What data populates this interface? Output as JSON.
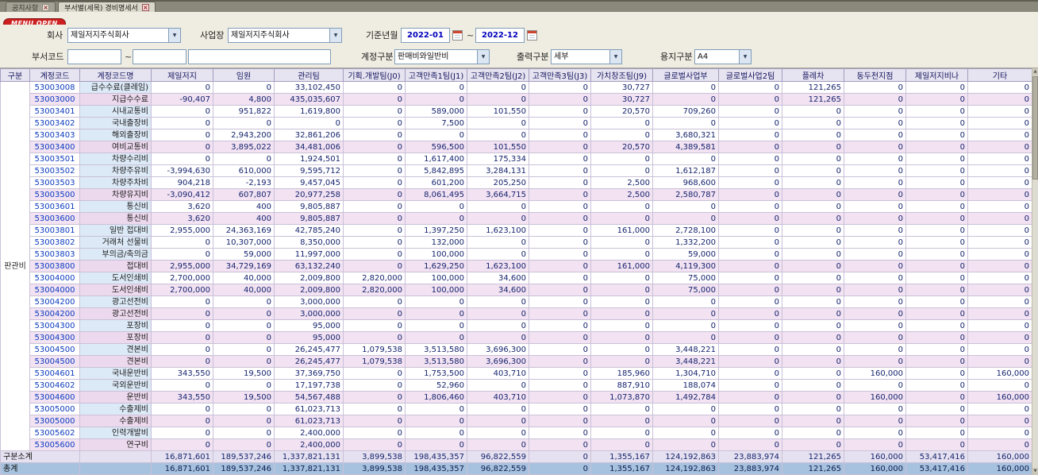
{
  "icons": {
    "close": "×",
    "dropdown": "▼",
    "scroll_up": "▲",
    "scroll_down": "▼"
  },
  "tabs": [
    {
      "label": "공지사항"
    },
    {
      "label": "부서별(세목) 경비명세서"
    }
  ],
  "menu_open_label": "MENU OPEN",
  "filters": {
    "company": {
      "label": "회사",
      "value": "제일저지주식회사"
    },
    "workplace": {
      "label": "사업장",
      "value": "제일저지주식회사"
    },
    "period": {
      "label": "기준년월",
      "from": "2022-01",
      "to": "2022-12",
      "separator": "~"
    },
    "dept_code": {
      "label": "부서코드",
      "from": "",
      "to": "",
      "separator": "~"
    },
    "account_type": {
      "label": "계정구분",
      "value": "판매비와일반비"
    },
    "output_type": {
      "label": "출력구분",
      "value": "세부"
    },
    "paper_type": {
      "label": "용지구분",
      "value": "A4"
    }
  },
  "grid": {
    "columns": [
      "구분",
      "계정코드",
      "계정코드명",
      "제일저지",
      "임원",
      "관리팀",
      "기획.개발팀(J0)",
      "고객만족1팀(J1)",
      "고객만족2팀(J2)",
      "고객만족3팀(J3)",
      "가치창조팀(J9)",
      "글로벌사업부",
      "글로벌사업2팀",
      "플레차",
      "동두천지점",
      "제일저지비나",
      "기타"
    ],
    "group_label": "판관비",
    "rows": [
      {
        "code": "53003008",
        "name": "급수수료(클레임)",
        "kind": "detail",
        "values": [
          "0",
          "0",
          "33,102,450",
          "0",
          "0",
          "0",
          "0",
          "30,727",
          "0",
          "0",
          "121,265",
          "0",
          "0",
          "0"
        ]
      },
      {
        "code": "53003000",
        "name": "지급수수료",
        "kind": "sum",
        "values": [
          "-90,407",
          "4,800",
          "435,035,607",
          "0",
          "0",
          "0",
          "0",
          "30,727",
          "0",
          "0",
          "121,265",
          "0",
          "0",
          "0"
        ]
      },
      {
        "code": "53003401",
        "name": "시내교통비",
        "kind": "detail",
        "values": [
          "0",
          "951,822",
          "1,619,800",
          "0",
          "589,000",
          "101,550",
          "0",
          "20,570",
          "709,260",
          "0",
          "0",
          "0",
          "0",
          "0"
        ]
      },
      {
        "code": "53003402",
        "name": "국내출장비",
        "kind": "detail",
        "values": [
          "0",
          "0",
          "0",
          "0",
          "7,500",
          "0",
          "0",
          "0",
          "0",
          "0",
          "0",
          "0",
          "0",
          "0"
        ]
      },
      {
        "code": "53003403",
        "name": "해외출장비",
        "kind": "detail",
        "values": [
          "0",
          "2,943,200",
          "32,861,206",
          "0",
          "0",
          "0",
          "0",
          "0",
          "3,680,321",
          "0",
          "0",
          "0",
          "0",
          "0"
        ]
      },
      {
        "code": "53003400",
        "name": "여비교통비",
        "kind": "sum",
        "values": [
          "0",
          "3,895,022",
          "34,481,006",
          "0",
          "596,500",
          "101,550",
          "0",
          "20,570",
          "4,389,581",
          "0",
          "0",
          "0",
          "0",
          "0"
        ]
      },
      {
        "code": "53003501",
        "name": "차량수리비",
        "kind": "detail",
        "values": [
          "0",
          "0",
          "1,924,501",
          "0",
          "1,617,400",
          "175,334",
          "0",
          "0",
          "0",
          "0",
          "0",
          "0",
          "0",
          "0"
        ]
      },
      {
        "code": "53003502",
        "name": "차량주유비",
        "kind": "detail",
        "values": [
          "-3,994,630",
          "610,000",
          "9,595,712",
          "0",
          "5,842,895",
          "3,284,131",
          "0",
          "0",
          "1,612,187",
          "0",
          "0",
          "0",
          "0",
          "0"
        ]
      },
      {
        "code": "53003503",
        "name": "차량주차비",
        "kind": "detail",
        "values": [
          "904,218",
          "-2,193",
          "9,457,045",
          "0",
          "601,200",
          "205,250",
          "0",
          "2,500",
          "968,600",
          "0",
          "0",
          "0",
          "0",
          "0"
        ]
      },
      {
        "code": "53003500",
        "name": "차량유지비",
        "kind": "sum",
        "values": [
          "-3,090,412",
          "607,807",
          "20,977,258",
          "0",
          "8,061,495",
          "3,664,715",
          "0",
          "2,500",
          "2,580,787",
          "0",
          "0",
          "0",
          "0",
          "0"
        ]
      },
      {
        "code": "53003601",
        "name": "통신비",
        "kind": "detail",
        "values": [
          "3,620",
          "400",
          "9,805,887",
          "0",
          "0",
          "0",
          "0",
          "0",
          "0",
          "0",
          "0",
          "0",
          "0",
          "0"
        ]
      },
      {
        "code": "53003600",
        "name": "통신비",
        "kind": "sum",
        "values": [
          "3,620",
          "400",
          "9,805,887",
          "0",
          "0",
          "0",
          "0",
          "0",
          "0",
          "0",
          "0",
          "0",
          "0",
          "0"
        ]
      },
      {
        "code": "53003801",
        "name": "일반 접대비",
        "kind": "detail",
        "values": [
          "2,955,000",
          "24,363,169",
          "42,785,240",
          "0",
          "1,397,250",
          "1,623,100",
          "0",
          "161,000",
          "2,728,100",
          "0",
          "0",
          "0",
          "0",
          "0"
        ]
      },
      {
        "code": "53003802",
        "name": "거래처 선물비",
        "kind": "detail",
        "values": [
          "0",
          "10,307,000",
          "8,350,000",
          "0",
          "132,000",
          "0",
          "0",
          "0",
          "1,332,200",
          "0",
          "0",
          "0",
          "0",
          "0"
        ]
      },
      {
        "code": "53003803",
        "name": "부의금/축의금",
        "kind": "detail",
        "values": [
          "0",
          "59,000",
          "11,997,000",
          "0",
          "100,000",
          "0",
          "0",
          "0",
          "59,000",
          "0",
          "0",
          "0",
          "0",
          "0"
        ]
      },
      {
        "code": "53003800",
        "name": "접대비",
        "kind": "sum",
        "values": [
          "2,955,000",
          "34,729,169",
          "63,132,240",
          "0",
          "1,629,250",
          "1,623,100",
          "0",
          "161,000",
          "4,119,300",
          "0",
          "0",
          "0",
          "0",
          "0"
        ]
      },
      {
        "code": "53004000",
        "name": "도서인쇄비",
        "kind": "detail",
        "values": [
          "2,700,000",
          "40,000",
          "2,009,800",
          "2,820,000",
          "100,000",
          "34,600",
          "0",
          "0",
          "75,000",
          "0",
          "0",
          "0",
          "0",
          "0"
        ]
      },
      {
        "code": "53004000",
        "name": "도서인쇄비",
        "kind": "sum",
        "values": [
          "2,700,000",
          "40,000",
          "2,009,800",
          "2,820,000",
          "100,000",
          "34,600",
          "0",
          "0",
          "75,000",
          "0",
          "0",
          "0",
          "0",
          "0"
        ]
      },
      {
        "code": "53004200",
        "name": "광고선전비",
        "kind": "detail",
        "values": [
          "0",
          "0",
          "3,000,000",
          "0",
          "0",
          "0",
          "0",
          "0",
          "0",
          "0",
          "0",
          "0",
          "0",
          "0"
        ]
      },
      {
        "code": "53004200",
        "name": "광고선전비",
        "kind": "sum",
        "values": [
          "0",
          "0",
          "3,000,000",
          "0",
          "0",
          "0",
          "0",
          "0",
          "0",
          "0",
          "0",
          "0",
          "0",
          "0"
        ]
      },
      {
        "code": "53004300",
        "name": "포장비",
        "kind": "detail",
        "values": [
          "0",
          "0",
          "95,000",
          "0",
          "0",
          "0",
          "0",
          "0",
          "0",
          "0",
          "0",
          "0",
          "0",
          "0"
        ]
      },
      {
        "code": "53004300",
        "name": "포장비",
        "kind": "sum",
        "values": [
          "0",
          "0",
          "95,000",
          "0",
          "0",
          "0",
          "0",
          "0",
          "0",
          "0",
          "0",
          "0",
          "0",
          "0"
        ]
      },
      {
        "code": "53004500",
        "name": "견본비",
        "kind": "detail",
        "values": [
          "0",
          "0",
          "26,245,477",
          "1,079,538",
          "3,513,580",
          "3,696,300",
          "0",
          "0",
          "3,448,221",
          "0",
          "0",
          "0",
          "0",
          "0"
        ]
      },
      {
        "code": "53004500",
        "name": "견본비",
        "kind": "sum",
        "values": [
          "0",
          "0",
          "26,245,477",
          "1,079,538",
          "3,513,580",
          "3,696,300",
          "0",
          "0",
          "3,448,221",
          "0",
          "0",
          "0",
          "0",
          "0"
        ]
      },
      {
        "code": "53004601",
        "name": "국내운반비",
        "kind": "detail",
        "values": [
          "343,550",
          "19,500",
          "37,369,750",
          "0",
          "1,753,500",
          "403,710",
          "0",
          "185,960",
          "1,304,710",
          "0",
          "0",
          "160,000",
          "0",
          "160,000"
        ]
      },
      {
        "code": "53004602",
        "name": "국외운반비",
        "kind": "detail",
        "values": [
          "0",
          "0",
          "17,197,738",
          "0",
          "52,960",
          "0",
          "0",
          "887,910",
          "188,074",
          "0",
          "0",
          "0",
          "0",
          "0"
        ]
      },
      {
        "code": "53004600",
        "name": "운반비",
        "kind": "sum",
        "values": [
          "343,550",
          "19,500",
          "54,567,488",
          "0",
          "1,806,460",
          "403,710",
          "0",
          "1,073,870",
          "1,492,784",
          "0",
          "0",
          "160,000",
          "0",
          "160,000"
        ]
      },
      {
        "code": "53005000",
        "name": "수출제비",
        "kind": "detail",
        "values": [
          "0",
          "0",
          "61,023,713",
          "0",
          "0",
          "0",
          "0",
          "0",
          "0",
          "0",
          "0",
          "0",
          "0",
          "0"
        ]
      },
      {
        "code": "53005000",
        "name": "수출제비",
        "kind": "sum",
        "values": [
          "0",
          "0",
          "61,023,713",
          "0",
          "0",
          "0",
          "0",
          "0",
          "0",
          "0",
          "0",
          "0",
          "0",
          "0"
        ]
      },
      {
        "code": "53005602",
        "name": "인력개발비",
        "kind": "detail",
        "values": [
          "0",
          "0",
          "2,400,000",
          "0",
          "0",
          "0",
          "0",
          "0",
          "0",
          "0",
          "0",
          "0",
          "0",
          "0"
        ]
      },
      {
        "code": "53005600",
        "name": "연구비",
        "kind": "sum",
        "values": [
          "0",
          "0",
          "2,400,000",
          "0",
          "0",
          "0",
          "0",
          "0",
          "0",
          "0",
          "0",
          "0",
          "0",
          "0"
        ]
      }
    ],
    "subtotal_label": "구분소계",
    "subtotal_values": [
      "16,871,601",
      "189,537,246",
      "1,337,821,131",
      "3,899,538",
      "198,435,357",
      "96,822,559",
      "0",
      "1,355,167",
      "124,192,863",
      "23,883,974",
      "121,265",
      "160,000",
      "53,417,416",
      "160,000"
    ],
    "total_label": "총계",
    "total_values": [
      "16,871,601",
      "189,537,246",
      "1,337,821,131",
      "3,899,538",
      "198,435,357",
      "96,822,559",
      "0",
      "1,355,167",
      "124,192,863",
      "23,883,974",
      "121,265",
      "160,000",
      "53,417,416",
      "160,000"
    ]
  }
}
